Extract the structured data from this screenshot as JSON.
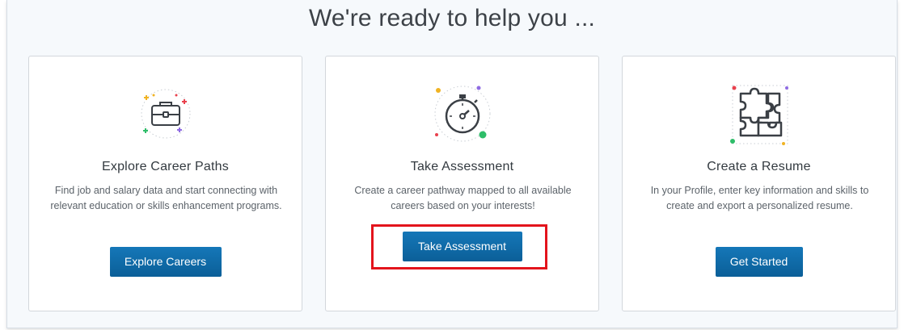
{
  "headline": "We're ready to help you ...",
  "cards": [
    {
      "icon": "briefcase-icon",
      "title": "Explore Career Paths",
      "description": "Find job and salary data and start connecting with relevant education or skills enhancement programs.",
      "button_label": "Explore Careers"
    },
    {
      "icon": "stopwatch-icon",
      "title": "Take Assessment",
      "description": "Create a career pathway mapped to all available careers based on your interests!",
      "button_label": "Take Assessment"
    },
    {
      "icon": "puzzle-icon",
      "title": "Create a Resume",
      "description": "In your Profile, enter key information and skills to create and export a personalized resume.",
      "button_label": "Get Started"
    }
  ],
  "colors": {
    "button": "#0b6aa8",
    "highlight": "#e3141c",
    "icon_stroke": "#3a3f45"
  }
}
